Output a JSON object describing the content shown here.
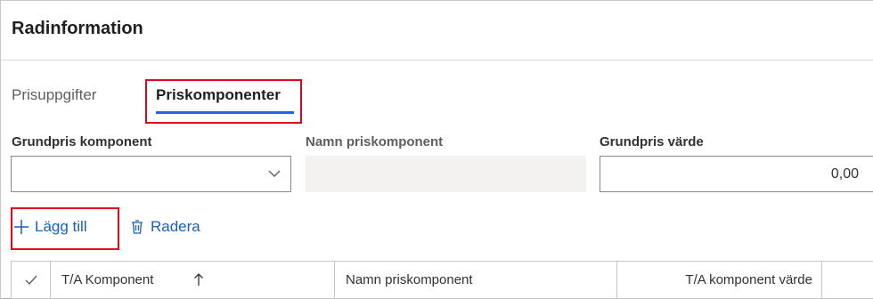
{
  "panel": {
    "title": "Radinformation"
  },
  "tabs": [
    {
      "label": "Prisuppgifter",
      "active": false
    },
    {
      "label": "Priskomponenter",
      "active": true
    }
  ],
  "fields": {
    "base_component": {
      "label": "Grundpris komponent",
      "value": ""
    },
    "component_name": {
      "label": "Namn priskomponent",
      "value": ""
    },
    "base_value": {
      "label": "Grundpris värde",
      "value": "0,00"
    }
  },
  "actions": {
    "add": {
      "label": "Lägg till",
      "icon": "plus-icon"
    },
    "delete": {
      "label": "Radera",
      "icon": "trash-icon"
    }
  },
  "grid": {
    "columns": [
      {
        "label": "",
        "icon": "checkmark-icon"
      },
      {
        "label": "T/A Komponent",
        "sort": "ascending"
      },
      {
        "label": "Namn priskomponent"
      },
      {
        "label": "T/A komponent värde"
      }
    ]
  },
  "colors": {
    "accent": "#2266e3",
    "link": "#1a5fb4",
    "highlight": "#e3001b"
  }
}
